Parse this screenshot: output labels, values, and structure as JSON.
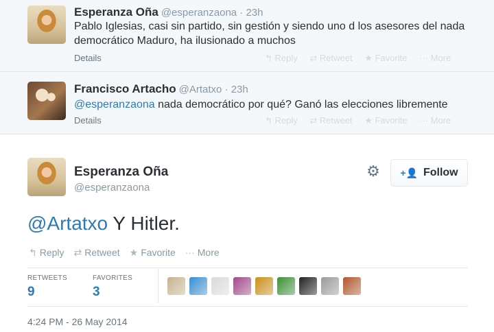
{
  "reply1": {
    "name": "Esperanza Oña",
    "handle": "@esperanzaona · 23h",
    "text": "Pablo Iglesias, casi sin partido, sin gestión y siendo uno d los asesores del nada democrático Maduro, ha ilusionado a muchos",
    "details": "Details",
    "actions": [
      "↰ Reply",
      "⇄ Retweet",
      "★ Favorite",
      "··· More"
    ]
  },
  "reply2": {
    "name": "Francisco Artacho",
    "handle": "@Artatxo · 23h",
    "mention": "@esperanzaona",
    "text": " nada democrático por qué? Ganó las elecciones libremente",
    "details": "Details",
    "actions": [
      "↰ Reply",
      "⇄ Retweet",
      "★ Favorite",
      "··· More"
    ]
  },
  "main": {
    "name": "Esperanza Oña",
    "handle": "@esperanzaona",
    "follow_label": "Follow",
    "mention": "@Artatxo",
    "text": " Y Hitler.",
    "actions": {
      "reply": "Reply",
      "retweet": "Retweet",
      "favorite": "Favorite",
      "more": "More"
    },
    "stats": {
      "retweets_label": "RETWEETS",
      "retweets_value": "9",
      "favorites_label": "FAVORITES",
      "favorites_value": "3"
    },
    "timestamp": "4:24 PM - 26 May 2014"
  },
  "colors": {
    "link": "#2b7bb9",
    "muted": "#8899a6",
    "context_bg": "#f5f8fa"
  },
  "favoriter_avatars": [
    "#c8b28e",
    "#3a8fd0",
    "#d9d9d9",
    "#a34a8c",
    "#c98f1b",
    "#3f8f3a",
    "#222222",
    "#9a9a9a",
    "#b0582e"
  ]
}
